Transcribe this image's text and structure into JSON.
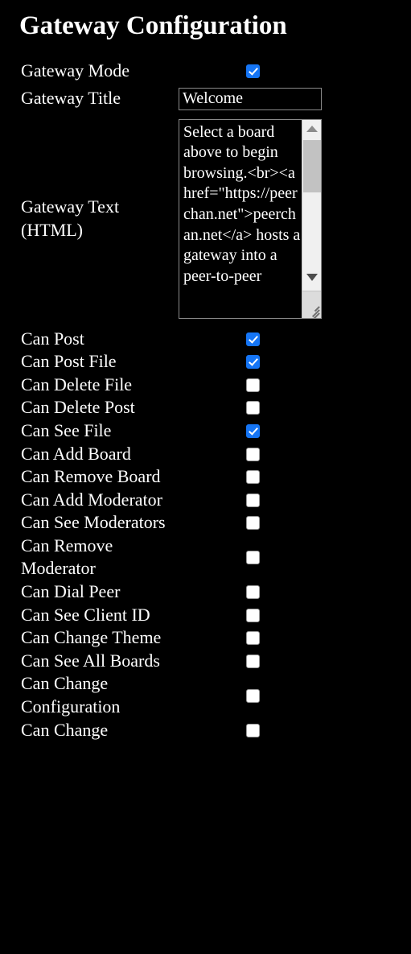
{
  "page": {
    "title": "Gateway Configuration",
    "background_color": "#000000",
    "text_color": "#ffffff",
    "checkbox_checked_color": "#1575f5"
  },
  "form": {
    "gateway_mode": {
      "label": "Gateway Mode",
      "type": "checkbox",
      "checked": true
    },
    "gateway_title": {
      "label": "Gateway Title",
      "type": "text",
      "value": "Welcome",
      "placeholder": ""
    },
    "gateway_text": {
      "label": "Gateway Text (HTML)",
      "label_line1": "Gateway Text",
      "label_line2": "(HTML)",
      "type": "textarea",
      "value": "Select a board above to begin browsing.<br><a href=\"https://peerchan.net\">peerchan.net</a> hosts a gateway into a peer-to-peer",
      "scroll_position": "top"
    },
    "permissions": [
      {
        "label": "Can Post",
        "checked": true
      },
      {
        "label": "Can Post File",
        "checked": true
      },
      {
        "label": "Can Delete File",
        "checked": false
      },
      {
        "label": "Can Delete Post",
        "checked": false
      },
      {
        "label": "Can See File",
        "checked": true
      },
      {
        "label": "Can Add Board",
        "checked": false
      },
      {
        "label": "Can Remove Board",
        "checked": false
      },
      {
        "label": "Can Add Moderator",
        "checked": false
      },
      {
        "label": "Can See Moderators",
        "checked": false
      },
      {
        "label": "Can Remove Moderator",
        "checked": false
      },
      {
        "label": "Can Dial Peer",
        "checked": false
      },
      {
        "label": "Can See Client ID",
        "checked": false
      },
      {
        "label": "Can Change Theme",
        "checked": false
      },
      {
        "label": "Can See All Boards",
        "checked": false
      },
      {
        "label": "Can Change Configuration",
        "checked": false
      },
      {
        "label": "Can Change",
        "checked": false
      }
    ]
  }
}
